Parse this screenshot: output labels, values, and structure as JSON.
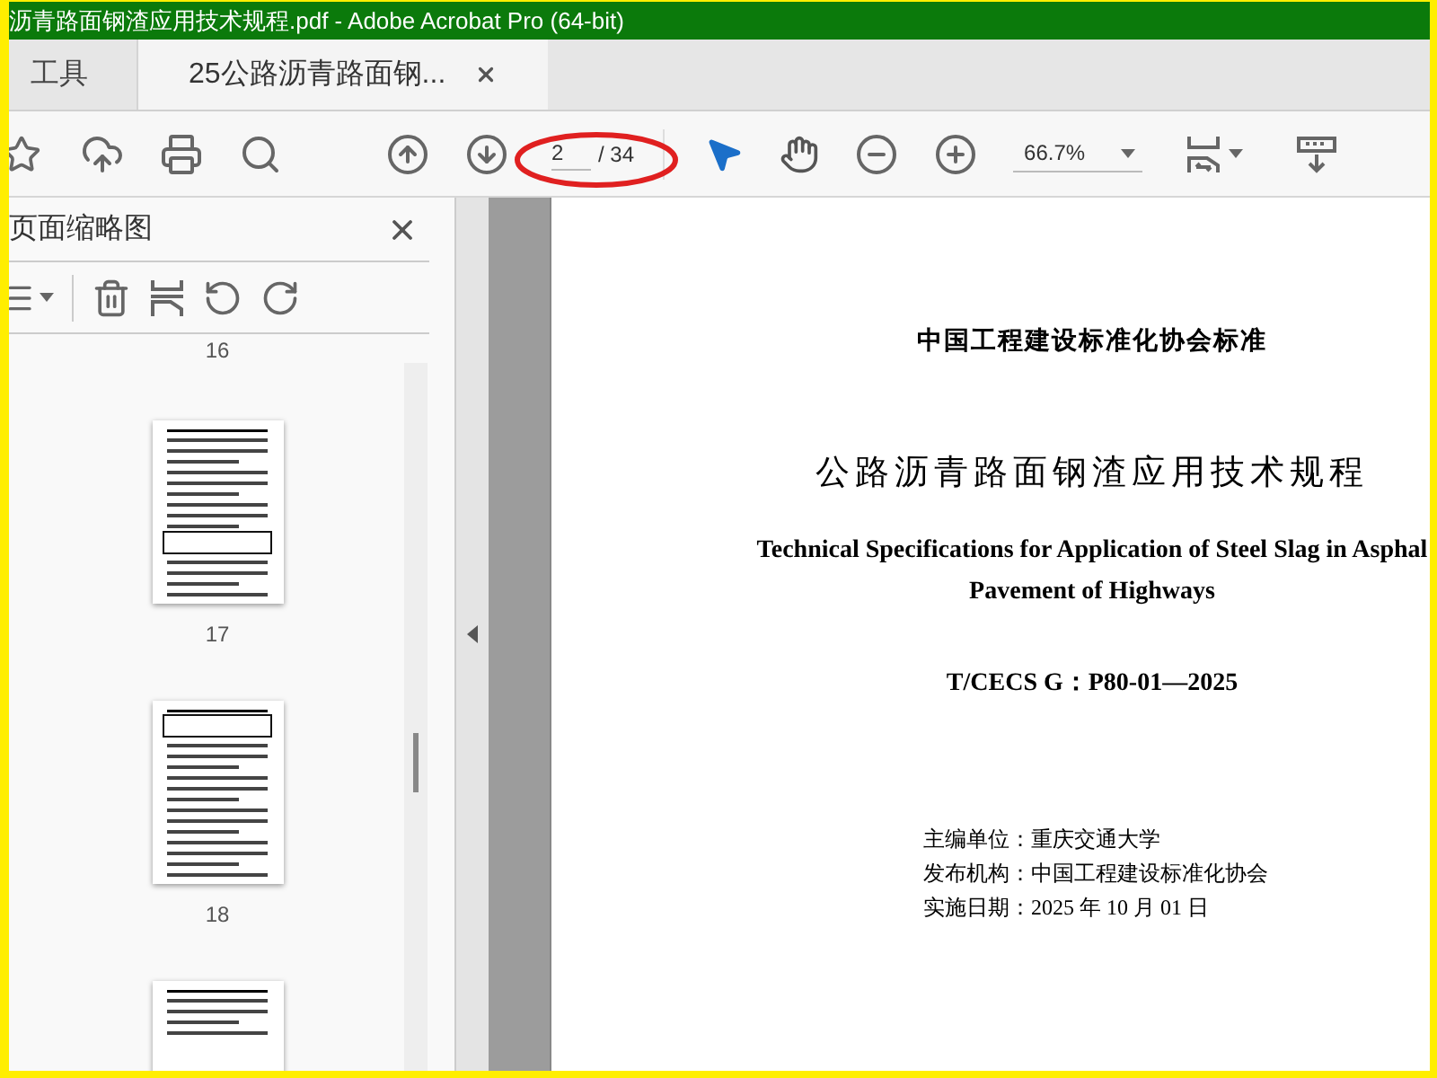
{
  "window": {
    "title": "沥青路面钢渣应用技术规程.pdf - Adobe Acrobat Pro (64-bit)"
  },
  "tabs": [
    {
      "label": "工具",
      "selected": false
    },
    {
      "label": "25公路沥青路面钢...",
      "selected": true
    }
  ],
  "toolbar": {
    "page_current": "2",
    "page_total": "/ 34",
    "zoom": "66.7%",
    "tools": [
      {
        "kind": "select",
        "selected": true
      },
      {
        "kind": "hand",
        "selected": false
      }
    ]
  },
  "sidebar": {
    "title": "页面缩略图",
    "thumbnails": [
      {
        "label": "16"
      },
      {
        "label": "17",
        "kind": "table-bottom"
      },
      {
        "label": "18",
        "kind": "table-top"
      },
      {
        "kind": "sparse"
      }
    ]
  },
  "document": {
    "org": "中国工程建设标准化协会标准",
    "title_cn": "公路沥青路面钢渣应用技术规程",
    "title_en": [
      "Technical Specifications for Application of Steel Slag in Asphal",
      "Pavement of Highways"
    ],
    "code": "T/CECS G：P80-01—2025",
    "info": [
      "主编单位：重庆交通大学",
      "发布机构：中国工程建设标准化协会",
      "实施日期：2025 年 10 月 01 日"
    ]
  }
}
